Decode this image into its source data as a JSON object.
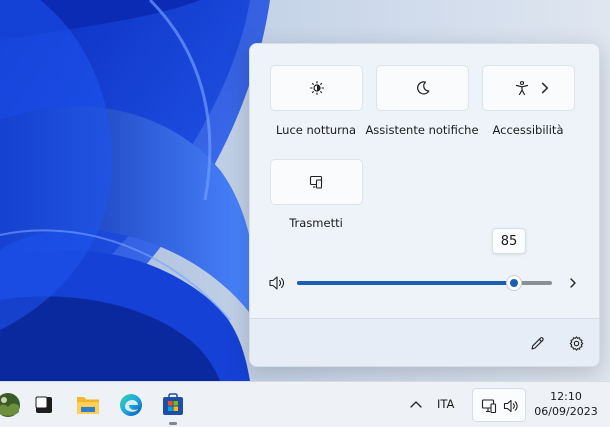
{
  "quick_settings": {
    "tiles": [
      {
        "label": "Luce notturna",
        "icon": "brightness-icon"
      },
      {
        "label": "Assistente notifiche",
        "icon": "moon-icon"
      },
      {
        "label": "Accessibilità",
        "icon": "accessibility-icon",
        "has_submenu": true
      },
      {
        "label": "Trasmetti",
        "icon": "cast-icon"
      }
    ],
    "volume": {
      "value": 85,
      "label": "85",
      "max": 100,
      "icon": "speaker-icon"
    },
    "footer": {
      "edit_icon": "pencil-icon",
      "settings_icon": "gear-icon"
    }
  },
  "taskbar": {
    "apps": [
      "photos-icon",
      "task-view-icon",
      "file-explorer-icon",
      "edge-icon",
      "store-icon"
    ],
    "tray": {
      "language": "ITA",
      "network_icon": "network-icon",
      "volume_icon": "speaker-icon"
    },
    "clock": {
      "time": "12:10",
      "date": "06/09/2023"
    }
  },
  "colors": {
    "accent": "#1a5fb4",
    "wallpaper": "#1b4fe0"
  }
}
